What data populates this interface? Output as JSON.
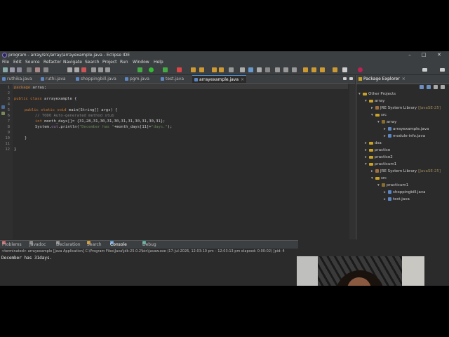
{
  "window": {
    "title": "program - array/src/array/arrayexample.java - Eclipse IDE"
  },
  "menu": [
    "File",
    "Edit",
    "Source",
    "Refactor",
    "Navigate",
    "Search",
    "Project",
    "Run",
    "Window",
    "Help"
  ],
  "editor_tabs": [
    {
      "label": "ruthika.java"
    },
    {
      "label": "ruthi.java"
    },
    {
      "label": "shoppingbill.java"
    },
    {
      "label": "pgm.java"
    },
    {
      "label": "test.java"
    },
    {
      "label": "arrayexample.java",
      "active": true,
      "close": "×"
    }
  ],
  "code": {
    "line_numbers": [
      "1",
      "2",
      "3",
      "4",
      "5",
      "6",
      "7",
      "8",
      "9",
      "10",
      "11",
      "12"
    ],
    "line1_kw": "package",
    "line1_rest": " array;",
    "line3_kw": "public class",
    "line3_rest": " arrayexample {",
    "line5_kw": "public static void",
    "line5_rest": " main(String[] args) {",
    "line6": "// TODO Auto-generated method stub",
    "line7_kw": "int",
    "line7_rest": " month_days[]= {31,28,31,30,31,30,31,31,30,31,30,31};",
    "line8_a": "System.",
    "line8_fld": "out",
    "line8_b": ".println(",
    "line8_str1": "\"December has \"",
    "line8_c": "+month_days[11]+",
    "line8_str2": "\"days.\"",
    "line8_d": ");",
    "line10": "}",
    "line12": "}"
  },
  "bottom_tabs": [
    "Problems",
    "Javadoc",
    "Declaration",
    "Search",
    "Console",
    "Debug"
  ],
  "console": {
    "status": "<terminated> arrayexample [Java Application] C:\\Program Files\\Java\\jdk-25.0.2\\bin\\javaw.exe  (17-Jul-2026, 12:03:10 pm – 12:03:13 pm elapsed: 0:00:02) [pid: 4",
    "output": "December has 31days."
  },
  "package_explorer": {
    "tab_label": "Package Explorer",
    "items": [
      {
        "label": "Other Projects",
        "indent": 0,
        "type": "folder",
        "arrow": "▾"
      },
      {
        "label": "array",
        "indent": 1,
        "type": "folder",
        "arrow": "▾"
      },
      {
        "label": "JRE System Library",
        "extra": "[JavaSE-25]",
        "indent": 2,
        "type": "lib",
        "arrow": "▸"
      },
      {
        "label": "src",
        "indent": 2,
        "type": "folder",
        "arrow": "▾"
      },
      {
        "label": "array",
        "indent": 3,
        "type": "pkg",
        "arrow": "▾"
      },
      {
        "label": "arrayexample.java",
        "indent": 4,
        "type": "java",
        "arrow": "▸"
      },
      {
        "label": "module-info.java",
        "indent": 4,
        "type": "java",
        "arrow": "▸"
      },
      {
        "label": "dsa",
        "indent": 1,
        "type": "folder",
        "arrow": "▸"
      },
      {
        "label": "practice",
        "indent": 1,
        "type": "folder",
        "arrow": "▸"
      },
      {
        "label": "practice2",
        "indent": 1,
        "type": "folder",
        "arrow": "▸"
      },
      {
        "label": "practicum1",
        "indent": 1,
        "type": "folder",
        "arrow": "▾"
      },
      {
        "label": "JRE System Library",
        "extra": "[JavaSE-25]",
        "indent": 2,
        "type": "lib",
        "arrow": "▸"
      },
      {
        "label": "src",
        "indent": 2,
        "type": "folder",
        "arrow": "▾"
      },
      {
        "label": "practicum1",
        "indent": 3,
        "type": "pkg",
        "arrow": "▾"
      },
      {
        "label": "shoppingbill.java",
        "indent": 4,
        "type": "java",
        "arrow": "▸"
      },
      {
        "label": "test.java",
        "indent": 4,
        "type": "java",
        "arrow": "▸"
      }
    ]
  },
  "colors": {
    "keyword": "#cc7832",
    "string": "#6a8759",
    "field": "#9876aa",
    "comment": "#808080"
  }
}
